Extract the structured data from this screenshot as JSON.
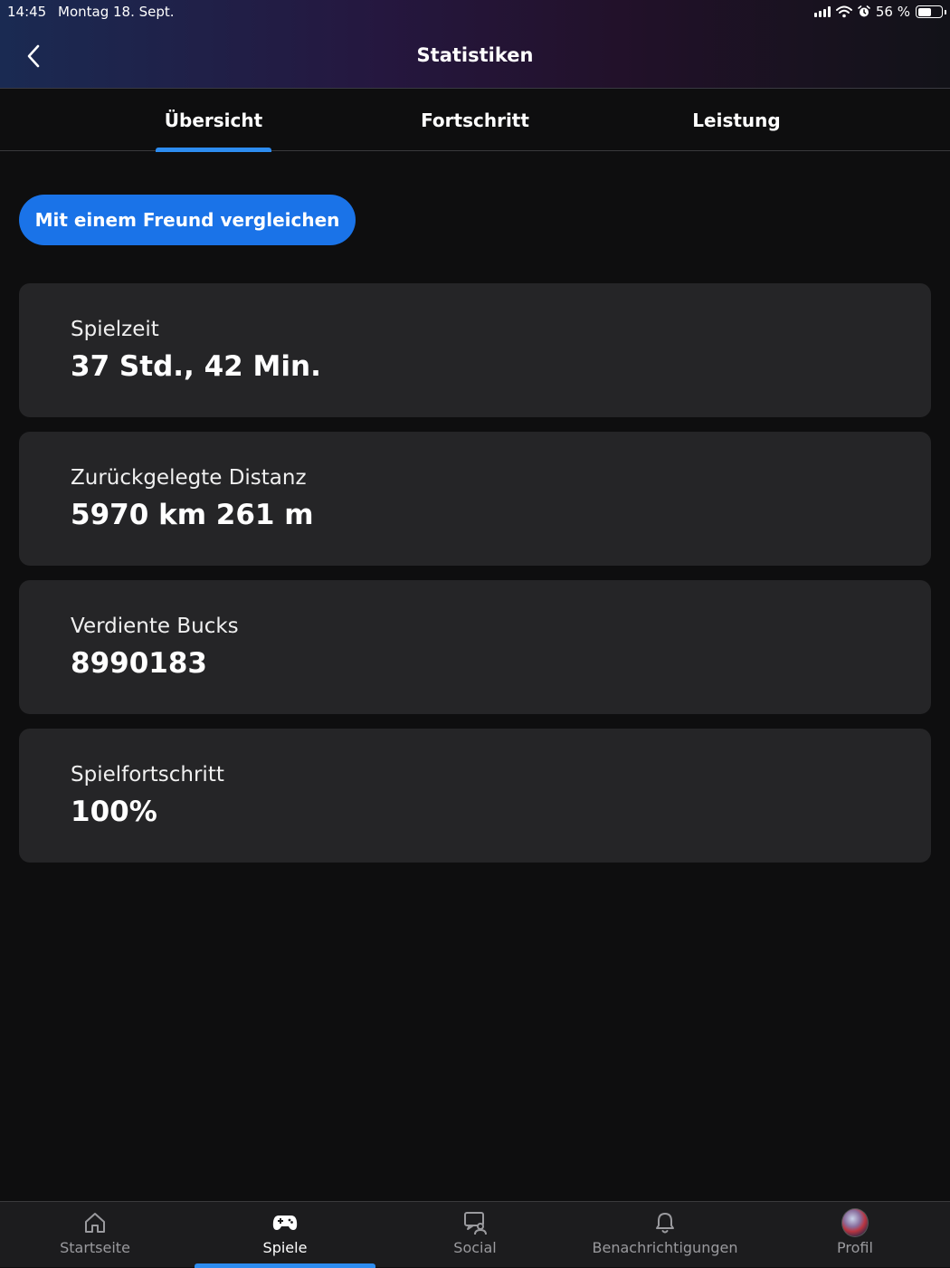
{
  "status_bar": {
    "time": "14:45",
    "date": "Montag 18. Sept.",
    "battery_text": "56 %",
    "battery_level": 0.56
  },
  "header": {
    "title": "Statistiken",
    "back_icon": "chevron-left-icon"
  },
  "tabs": [
    {
      "label": "Übersicht",
      "active": true
    },
    {
      "label": "Fortschritt",
      "active": false
    },
    {
      "label": "Leistung",
      "active": false
    }
  ],
  "compare_button": {
    "label": "Mit einem Freund vergleichen"
  },
  "stats": [
    {
      "label": "Spielzeit",
      "value": "37 Std., 42 Min."
    },
    {
      "label": "Zurückgelegte Distanz",
      "value": "5970 km 261 m"
    },
    {
      "label": "Verdiente Bucks",
      "value": "8990183"
    },
    {
      "label": "Spielfortschritt",
      "value": "100%"
    }
  ],
  "bottom_nav": [
    {
      "label": "Startseite",
      "icon": "home-icon",
      "active": false
    },
    {
      "label": "Spiele",
      "icon": "gamepad-icon",
      "active": true
    },
    {
      "label": "Social",
      "icon": "social-icon",
      "active": false
    },
    {
      "label": "Benachrichtigungen",
      "icon": "bell-icon",
      "active": false
    },
    {
      "label": "Profil",
      "icon": "avatar",
      "active": false
    }
  ],
  "colors": {
    "accent": "#2d8cf0",
    "button": "#1a73e8",
    "card": "#252527",
    "background": "#0e0e0f"
  }
}
